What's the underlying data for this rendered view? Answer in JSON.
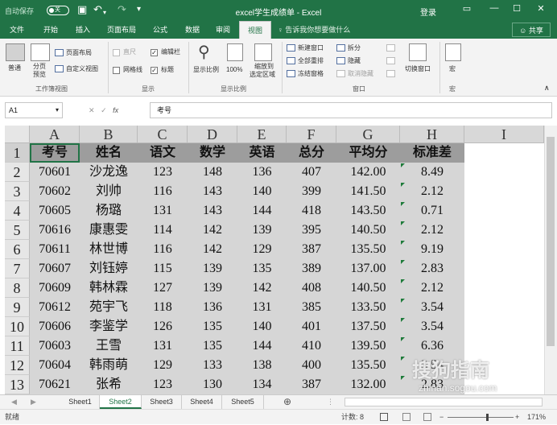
{
  "titlebar": {
    "autosave": "自动保存",
    "toggle": "关",
    "title": "excel学生成绩单 - Excel",
    "login": "登录"
  },
  "tabs": [
    "文件",
    "开始",
    "插入",
    "页面布局",
    "公式",
    "数据",
    "审阅",
    "视图"
  ],
  "active_tab": "视图",
  "tellme": "告诉我你想要做什么",
  "share": "共享",
  "ribbon": {
    "normal": "普通",
    "pagebreak_1": "分页",
    "pagebreak_2": "预览",
    "pagelayout": "页面布局",
    "custom": "自定义视图",
    "ruler": "直尺",
    "editbar": "编辑栏",
    "gridlines": "网格线",
    "headings": "标题",
    "zoom": "显示比例",
    "zoom100": "100%",
    "zoomsel_1": "缩放到",
    "zoomsel_2": "选定区域",
    "newwin": "新建窗口",
    "arrange": "全部重排",
    "freeze": "冻结窗格",
    "split": "拆分",
    "hide": "隐藏",
    "unhide": "取消隐藏",
    "switch": "切换窗口",
    "macro": "宏",
    "grp_workbook": "工作簿视图",
    "grp_show": "显示",
    "grp_zoom": "显示比例",
    "grp_window": "窗口",
    "grp_macro": "宏"
  },
  "formula": {
    "namebox": "A1",
    "value": "考号",
    "fx": "fx"
  },
  "sheet": {
    "columns": [
      "A",
      "B",
      "C",
      "D",
      "E",
      "F",
      "G",
      "H",
      "I"
    ],
    "row_numbers": [
      "1",
      "2",
      "3",
      "4",
      "5",
      "6",
      "7",
      "8",
      "9",
      "10",
      "11",
      "12",
      "13"
    ],
    "header": [
      "考号",
      "姓名",
      "语文",
      "数学",
      "英语",
      "总分",
      "平均分",
      "标准差"
    ],
    "rows": [
      [
        "70601",
        "沙龙逸",
        "123",
        "148",
        "136",
        "407",
        "142.00",
        "8.49"
      ],
      [
        "70602",
        "刘帅",
        "116",
        "143",
        "140",
        "399",
        "141.50",
        "2.12"
      ],
      [
        "70605",
        "杨璐",
        "131",
        "143",
        "144",
        "418",
        "143.50",
        "0.71"
      ],
      [
        "70616",
        "康惠雯",
        "114",
        "142",
        "139",
        "395",
        "140.50",
        "2.12"
      ],
      [
        "70611",
        "林世博",
        "116",
        "142",
        "129",
        "387",
        "135.50",
        "9.19"
      ],
      [
        "70607",
        "刘钰婷",
        "115",
        "139",
        "135",
        "389",
        "137.00",
        "2.83"
      ],
      [
        "70609",
        "韩林霖",
        "127",
        "139",
        "142",
        "408",
        "140.50",
        "2.12"
      ],
      [
        "70612",
        "苑宇飞",
        "118",
        "136",
        "131",
        "385",
        "133.50",
        "3.54"
      ],
      [
        "70606",
        "李鉴学",
        "126",
        "135",
        "140",
        "401",
        "137.50",
        "3.54"
      ],
      [
        "70603",
        "王雪",
        "131",
        "135",
        "144",
        "410",
        "139.50",
        "6.36"
      ],
      [
        "70604",
        "韩雨萌",
        "129",
        "133",
        "138",
        "400",
        "135.50",
        "3.54"
      ],
      [
        "70621",
        "张希",
        "123",
        "130",
        "134",
        "387",
        "132.00",
        "2.83"
      ]
    ]
  },
  "sheets": [
    "Sheet1",
    "Sheet2",
    "Sheet3",
    "Sheet4",
    "Sheet5"
  ],
  "active_sheet": "Sheet2",
  "status": {
    "ready": "就绪",
    "count": "计数: 8",
    "zoom": "171%"
  },
  "watermark": {
    "text": "搜狗指南",
    "sub": "zhinan.sogou.com"
  }
}
